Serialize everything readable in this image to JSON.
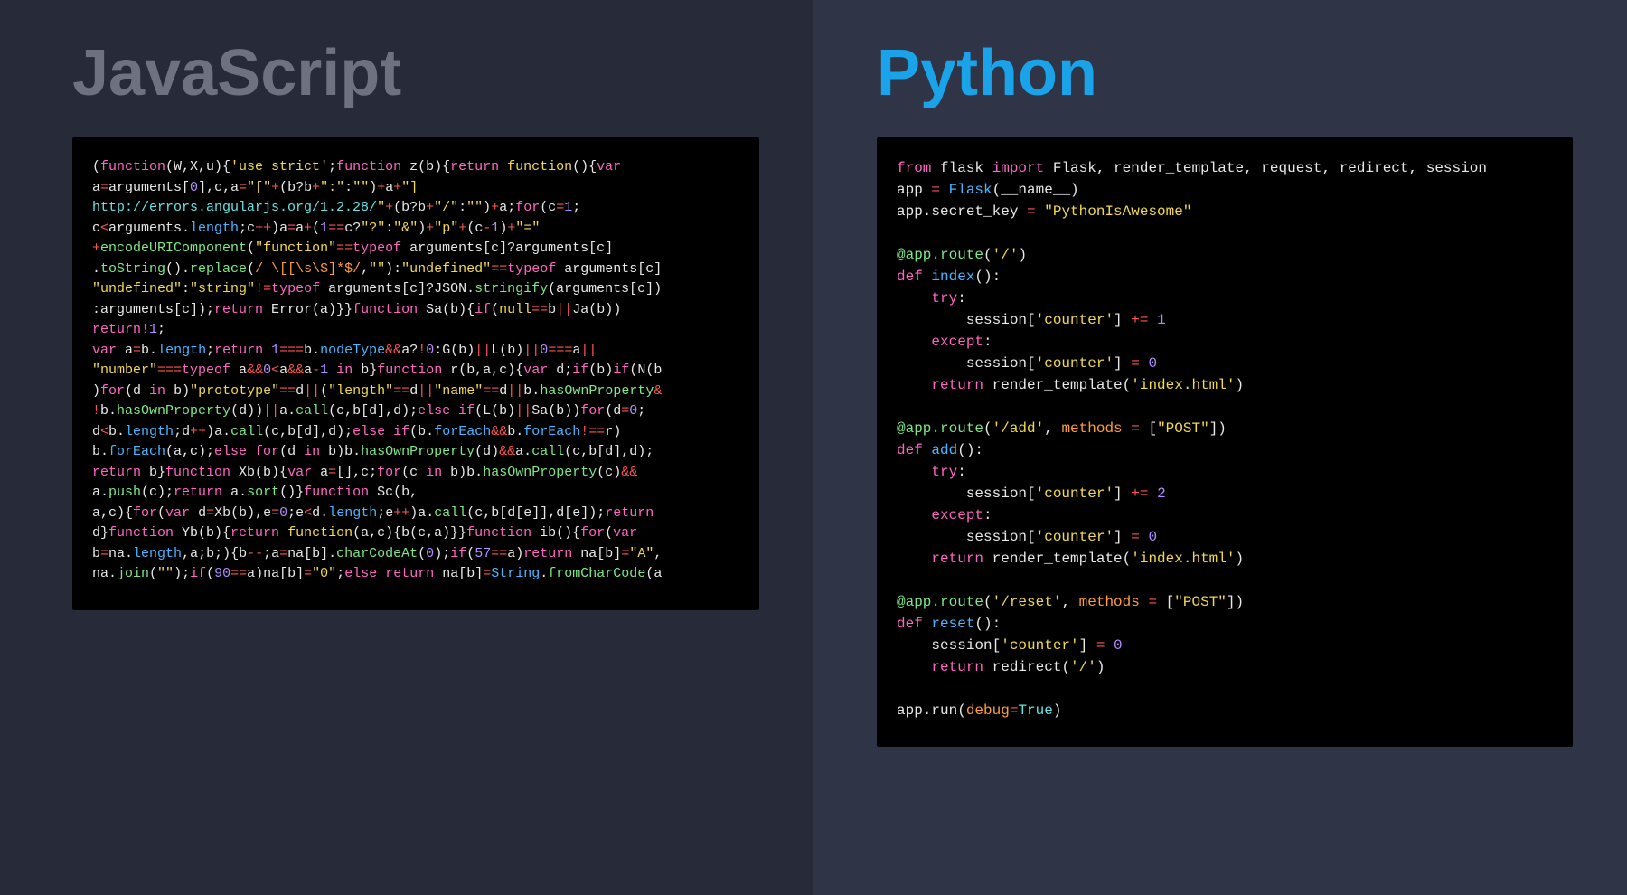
{
  "left": {
    "title": "JavaScript",
    "code_tokens": [
      [
        "w",
        "("
      ],
      [
        "p",
        "function"
      ],
      [
        "w",
        "(W,X,u){"
      ],
      [
        "y",
        "'use strict'"
      ],
      [
        "w",
        ";"
      ],
      [
        "p",
        "function"
      ],
      [
        "w",
        " z(b){"
      ],
      [
        "p",
        "return "
      ],
      [
        "y",
        "function"
      ],
      [
        "w",
        "(){"
      ],
      [
        "p",
        "var"
      ],
      [
        "w",
        "\na"
      ],
      [
        "r",
        "="
      ],
      [
        "w",
        "arguments["
      ],
      [
        "pu",
        "0"
      ],
      [
        "w",
        "],c,a"
      ],
      [
        "r",
        "="
      ],
      [
        "y",
        "\"[\""
      ],
      [
        "r",
        "+"
      ],
      [
        "w",
        "(b?b"
      ],
      [
        "r",
        "+"
      ],
      [
        "y",
        "\":\""
      ],
      [
        "w",
        ":"
      ],
      [
        "y",
        "\"\""
      ],
      [
        "w",
        ")"
      ],
      [
        "r",
        "+"
      ],
      [
        "w",
        "a"
      ],
      [
        "r",
        "+"
      ],
      [
        "y",
        "\"]"
      ],
      [
        "w",
        "\n"
      ],
      [
        "cy",
        "http://errors.angularjs.org/1.2.28/"
      ],
      [
        "y",
        "\""
      ],
      [
        "r",
        "+"
      ],
      [
        "w",
        "(b?b"
      ],
      [
        "r",
        "+"
      ],
      [
        "y",
        "\"/\""
      ],
      [
        "w",
        ":"
      ],
      [
        "y",
        "\"\""
      ],
      [
        "w",
        ")"
      ],
      [
        "r",
        "+"
      ],
      [
        "w",
        "a;"
      ],
      [
        "p",
        "for"
      ],
      [
        "w",
        "(c"
      ],
      [
        "r",
        "="
      ],
      [
        "pu",
        "1"
      ],
      [
        "w",
        ";\nc"
      ],
      [
        "r",
        "<"
      ],
      [
        "w",
        "arguments."
      ],
      [
        "b",
        "length"
      ],
      [
        "w",
        ";c"
      ],
      [
        "r",
        "++"
      ],
      [
        "w",
        ")a"
      ],
      [
        "r",
        "="
      ],
      [
        "w",
        "a"
      ],
      [
        "r",
        "+"
      ],
      [
        "w",
        "("
      ],
      [
        "pu",
        "1"
      ],
      [
        "r",
        "=="
      ],
      [
        "w",
        "c?"
      ],
      [
        "y",
        "\"?\""
      ],
      [
        "w",
        ":"
      ],
      [
        "y",
        "\"&\""
      ],
      [
        "w",
        ")"
      ],
      [
        "r",
        "+"
      ],
      [
        "y",
        "\"p\""
      ],
      [
        "r",
        "+"
      ],
      [
        "w",
        "(c"
      ],
      [
        "r",
        "-"
      ],
      [
        "pu",
        "1"
      ],
      [
        "w",
        ")"
      ],
      [
        "r",
        "+"
      ],
      [
        "y",
        "\"=\""
      ],
      [
        "w",
        "\n"
      ],
      [
        "r",
        "+"
      ],
      [
        "g",
        "encodeURIComponent"
      ],
      [
        "w",
        "("
      ],
      [
        "y",
        "\"function\""
      ],
      [
        "r",
        "=="
      ],
      [
        "p",
        "typeof"
      ],
      [
        "w",
        " arguments[c]?arguments[c]\n."
      ],
      [
        "g",
        "toString"
      ],
      [
        "w",
        "()."
      ],
      [
        "g",
        "replace"
      ],
      [
        "w",
        "("
      ],
      [
        "o",
        "/ \\[[\\s\\S]*$/"
      ],
      [
        "w",
        ","
      ],
      [
        "y",
        "\"\""
      ],
      [
        "w",
        "):"
      ],
      [
        "y",
        "\"undefined\""
      ],
      [
        "r",
        "=="
      ],
      [
        "p",
        "typeof"
      ],
      [
        "w",
        " arguments[c]\n"
      ],
      [
        "y",
        "\"undefined\""
      ],
      [
        "w",
        ":"
      ],
      [
        "y",
        "\"string\""
      ],
      [
        "r",
        "!="
      ],
      [
        "p",
        "typeof"
      ],
      [
        "w",
        " arguments[c]?JSON."
      ],
      [
        "g",
        "stringify"
      ],
      [
        "w",
        "(arguments[c])\n:arguments[c]);"
      ],
      [
        "p",
        "return"
      ],
      [
        "w",
        " Error(a)}}"
      ],
      [
        "p",
        "function"
      ],
      [
        "w",
        " Sa(b){"
      ],
      [
        "p",
        "if"
      ],
      [
        "w",
        "("
      ],
      [
        "y",
        "null"
      ],
      [
        "r",
        "=="
      ],
      [
        "w",
        "b"
      ],
      [
        "r",
        "||"
      ],
      [
        "w",
        "Ja(b))\n"
      ],
      [
        "p",
        "return"
      ],
      [
        "r",
        "!"
      ],
      [
        "pu",
        "1"
      ],
      [
        "w",
        ";\n"
      ],
      [
        "p",
        "var"
      ],
      [
        "w",
        " a"
      ],
      [
        "r",
        "="
      ],
      [
        "w",
        "b."
      ],
      [
        "b",
        "length"
      ],
      [
        "w",
        ";"
      ],
      [
        "p",
        "return "
      ],
      [
        "pu",
        "1"
      ],
      [
        "r",
        "==="
      ],
      [
        "w",
        "b."
      ],
      [
        "b",
        "nodeType"
      ],
      [
        "r",
        "&&"
      ],
      [
        "w",
        "a?"
      ],
      [
        "r",
        "!"
      ],
      [
        "pu",
        "0"
      ],
      [
        "w",
        ":G(b)"
      ],
      [
        "r",
        "||"
      ],
      [
        "w",
        "L(b)"
      ],
      [
        "r",
        "||"
      ],
      [
        "pu",
        "0"
      ],
      [
        "r",
        "==="
      ],
      [
        "w",
        "a"
      ],
      [
        "r",
        "||"
      ],
      [
        "w",
        "\n"
      ],
      [
        "y",
        "\"number\""
      ],
      [
        "r",
        "==="
      ],
      [
        "p",
        "typeof"
      ],
      [
        "w",
        " a"
      ],
      [
        "r",
        "&&"
      ],
      [
        "pu",
        "0"
      ],
      [
        "r",
        "<"
      ],
      [
        "w",
        "a"
      ],
      [
        "r",
        "&&"
      ],
      [
        "w",
        "a"
      ],
      [
        "r",
        "-"
      ],
      [
        "pu",
        "1 "
      ],
      [
        "p",
        "in"
      ],
      [
        "w",
        " b}"
      ],
      [
        "p",
        "function"
      ],
      [
        "w",
        " r(b,a,c){"
      ],
      [
        "p",
        "var"
      ],
      [
        "w",
        " d;"
      ],
      [
        "p",
        "if"
      ],
      [
        "w",
        "(b)"
      ],
      [
        "p",
        "if"
      ],
      [
        "w",
        "(N(b\n)"
      ],
      [
        "p",
        "for"
      ],
      [
        "w",
        "(d "
      ],
      [
        "p",
        "in"
      ],
      [
        "w",
        " b)"
      ],
      [
        "y",
        "\"prototype\""
      ],
      [
        "r",
        "=="
      ],
      [
        "w",
        "d"
      ],
      [
        "r",
        "||"
      ],
      [
        "w",
        "("
      ],
      [
        "y",
        "\"length\""
      ],
      [
        "r",
        "=="
      ],
      [
        "w",
        "d"
      ],
      [
        "r",
        "||"
      ],
      [
        "y",
        "\"name\""
      ],
      [
        "r",
        "=="
      ],
      [
        "w",
        "d"
      ],
      [
        "r",
        "||"
      ],
      [
        "w",
        "b."
      ],
      [
        "g",
        "hasOwnProperty"
      ],
      [
        "r",
        "&\n!"
      ],
      [
        "w",
        "b."
      ],
      [
        "g",
        "hasOwnProperty"
      ],
      [
        "w",
        "(d))"
      ],
      [
        "r",
        "||"
      ],
      [
        "w",
        "a."
      ],
      [
        "g",
        "call"
      ],
      [
        "w",
        "(c,b[d],d);"
      ],
      [
        "p",
        "else if"
      ],
      [
        "w",
        "(L(b)"
      ],
      [
        "r",
        "||"
      ],
      [
        "w",
        "Sa(b))"
      ],
      [
        "p",
        "for"
      ],
      [
        "w",
        "(d"
      ],
      [
        "r",
        "="
      ],
      [
        "pu",
        "0"
      ],
      [
        "w",
        ";\nd"
      ],
      [
        "r",
        "<"
      ],
      [
        "w",
        "b."
      ],
      [
        "b",
        "length"
      ],
      [
        "w",
        ";d"
      ],
      [
        "r",
        "++"
      ],
      [
        "w",
        ")a."
      ],
      [
        "g",
        "call"
      ],
      [
        "w",
        "(c,b[d],d);"
      ],
      [
        "p",
        "else if"
      ],
      [
        "w",
        "(b."
      ],
      [
        "b",
        "forEach"
      ],
      [
        "r",
        "&&"
      ],
      [
        "w",
        "b."
      ],
      [
        "b",
        "forEach"
      ],
      [
        "r",
        "!=="
      ],
      [
        "w",
        "r)\nb."
      ],
      [
        "b",
        "forEach"
      ],
      [
        "w",
        "(a,c);"
      ],
      [
        "p",
        "else for"
      ],
      [
        "w",
        "(d "
      ],
      [
        "p",
        "in"
      ],
      [
        "w",
        " b)b."
      ],
      [
        "g",
        "hasOwnProperty"
      ],
      [
        "w",
        "(d)"
      ],
      [
        "r",
        "&&"
      ],
      [
        "w",
        "a."
      ],
      [
        "g",
        "call"
      ],
      [
        "w",
        "(c,b[d],d);\n"
      ],
      [
        "p",
        "return"
      ],
      [
        "w",
        " b}"
      ],
      [
        "p",
        "function"
      ],
      [
        "w",
        " Xb(b){"
      ],
      [
        "p",
        "var"
      ],
      [
        "w",
        " a"
      ],
      [
        "r",
        "="
      ],
      [
        "w",
        "[],c;"
      ],
      [
        "p",
        "for"
      ],
      [
        "w",
        "(c "
      ],
      [
        "p",
        "in"
      ],
      [
        "w",
        " b)b."
      ],
      [
        "g",
        "hasOwnProperty"
      ],
      [
        "w",
        "(c)"
      ],
      [
        "r",
        "&&"
      ],
      [
        "w",
        "\na."
      ],
      [
        "g",
        "push"
      ],
      [
        "w",
        "(c);"
      ],
      [
        "p",
        "return"
      ],
      [
        "w",
        " a."
      ],
      [
        "g",
        "sort"
      ],
      [
        "w",
        "()}"
      ],
      [
        "p",
        "function"
      ],
      [
        "w",
        " Sc(b,\na,c){"
      ],
      [
        "p",
        "for"
      ],
      [
        "w",
        "("
      ],
      [
        "p",
        "var"
      ],
      [
        "w",
        " d"
      ],
      [
        "r",
        "="
      ],
      [
        "w",
        "Xb(b),e"
      ],
      [
        "r",
        "="
      ],
      [
        "pu",
        "0"
      ],
      [
        "w",
        ";e"
      ],
      [
        "r",
        "<"
      ],
      [
        "w",
        "d."
      ],
      [
        "b",
        "length"
      ],
      [
        "w",
        ";e"
      ],
      [
        "r",
        "++"
      ],
      [
        "w",
        ")a."
      ],
      [
        "g",
        "call"
      ],
      [
        "w",
        "(c,b[d[e]],d[e]);"
      ],
      [
        "p",
        "return"
      ],
      [
        "w",
        "\nd}"
      ],
      [
        "p",
        "function"
      ],
      [
        "w",
        " Yb(b){"
      ],
      [
        "p",
        "return "
      ],
      [
        "y",
        "function"
      ],
      [
        "w",
        "(a,c){b(c,a)}}"
      ],
      [
        "p",
        "function"
      ],
      [
        "w",
        " ib(){"
      ],
      [
        "p",
        "for"
      ],
      [
        "w",
        "("
      ],
      [
        "p",
        "var"
      ],
      [
        "w",
        "\nb"
      ],
      [
        "r",
        "="
      ],
      [
        "w",
        "na."
      ],
      [
        "b",
        "length"
      ],
      [
        "w",
        ",a;b;){b"
      ],
      [
        "r",
        "--"
      ],
      [
        "w",
        ";a"
      ],
      [
        "r",
        "="
      ],
      [
        "w",
        "na[b]."
      ],
      [
        "g",
        "charCodeAt"
      ],
      [
        "w",
        "("
      ],
      [
        "pu",
        "0"
      ],
      [
        "w",
        ");"
      ],
      [
        "p",
        "if"
      ],
      [
        "w",
        "("
      ],
      [
        "pu",
        "57"
      ],
      [
        "r",
        "=="
      ],
      [
        "w",
        "a)"
      ],
      [
        "p",
        "return"
      ],
      [
        "w",
        " na[b]"
      ],
      [
        "r",
        "="
      ],
      [
        "y",
        "\"A\""
      ],
      [
        "w",
        ",\nna."
      ],
      [
        "g",
        "join"
      ],
      [
        "w",
        "("
      ],
      [
        "y",
        "\"\""
      ],
      [
        "w",
        ");"
      ],
      [
        "p",
        "if"
      ],
      [
        "w",
        "("
      ],
      [
        "pu",
        "90"
      ],
      [
        "r",
        "=="
      ],
      [
        "w",
        "a)na[b]"
      ],
      [
        "r",
        "="
      ],
      [
        "y",
        "\"0\""
      ],
      [
        "w",
        ";"
      ],
      [
        "p",
        "else return"
      ],
      [
        "w",
        " na[b]"
      ],
      [
        "r",
        "="
      ],
      [
        "b",
        "String"
      ],
      [
        "w",
        "."
      ],
      [
        "g",
        "fromCharCode"
      ],
      [
        "w",
        "(a"
      ]
    ]
  },
  "right": {
    "title": "Python",
    "code_tokens": [
      [
        "p",
        "from "
      ],
      [
        "w",
        "flask "
      ],
      [
        "p",
        "import "
      ],
      [
        "w",
        "Flask, render_template, request, redirect, session\n"
      ],
      [
        "w",
        "app "
      ],
      [
        "r",
        "= "
      ],
      [
        "b",
        "Flask"
      ],
      [
        "w",
        "(__name__)\n"
      ],
      [
        "w",
        "app.secret_key "
      ],
      [
        "r",
        "= "
      ],
      [
        "y",
        "\"PythonIsAwesome\""
      ],
      [
        "w",
        "\n\n"
      ],
      [
        "g",
        "@app.route"
      ],
      [
        "w",
        "("
      ],
      [
        "y",
        "'/'"
      ],
      [
        "w",
        ")\n"
      ],
      [
        "p",
        "def "
      ],
      [
        "b",
        "index"
      ],
      [
        "w",
        "():\n    "
      ],
      [
        "p",
        "try"
      ],
      [
        "w",
        ":\n        session["
      ],
      [
        "y",
        "'counter'"
      ],
      [
        "w",
        "] "
      ],
      [
        "r",
        "+= "
      ],
      [
        "pu",
        "1"
      ],
      [
        "w",
        "\n    "
      ],
      [
        "p",
        "except"
      ],
      [
        "w",
        ":\n        session["
      ],
      [
        "y",
        "'counter'"
      ],
      [
        "w",
        "] "
      ],
      [
        "r",
        "= "
      ],
      [
        "pu",
        "0"
      ],
      [
        "w",
        "\n    "
      ],
      [
        "p",
        "return "
      ],
      [
        "w",
        "render_template("
      ],
      [
        "y",
        "'index.html'"
      ],
      [
        "w",
        ")\n\n"
      ],
      [
        "g",
        "@app.route"
      ],
      [
        "w",
        "("
      ],
      [
        "y",
        "'/add'"
      ],
      [
        "w",
        ", "
      ],
      [
        "o",
        "methods"
      ],
      [
        "w",
        " "
      ],
      [
        "r",
        "="
      ],
      [
        "w",
        " ["
      ],
      [
        "y",
        "\"POST\""
      ],
      [
        "w",
        "])\n"
      ],
      [
        "p",
        "def "
      ],
      [
        "b",
        "add"
      ],
      [
        "w",
        "():\n    "
      ],
      [
        "p",
        "try"
      ],
      [
        "w",
        ":\n        session["
      ],
      [
        "y",
        "'counter'"
      ],
      [
        "w",
        "] "
      ],
      [
        "r",
        "+= "
      ],
      [
        "pu",
        "2"
      ],
      [
        "w",
        "\n    "
      ],
      [
        "p",
        "except"
      ],
      [
        "w",
        ":\n        session["
      ],
      [
        "y",
        "'counter'"
      ],
      [
        "w",
        "] "
      ],
      [
        "r",
        "= "
      ],
      [
        "pu",
        "0"
      ],
      [
        "w",
        "\n    "
      ],
      [
        "p",
        "return "
      ],
      [
        "w",
        "render_template("
      ],
      [
        "y",
        "'index.html'"
      ],
      [
        "w",
        ")\n\n"
      ],
      [
        "g",
        "@app.route"
      ],
      [
        "w",
        "("
      ],
      [
        "y",
        "'/reset'"
      ],
      [
        "w",
        ", "
      ],
      [
        "o",
        "methods"
      ],
      [
        "w",
        " "
      ],
      [
        "r",
        "="
      ],
      [
        "w",
        " ["
      ],
      [
        "y",
        "\"POST\""
      ],
      [
        "w",
        "])\n"
      ],
      [
        "p",
        "def "
      ],
      [
        "b",
        "reset"
      ],
      [
        "w",
        "():\n    session["
      ],
      [
        "y",
        "'counter'"
      ],
      [
        "w",
        "] "
      ],
      [
        "r",
        "= "
      ],
      [
        "pu",
        "0"
      ],
      [
        "w",
        "\n    "
      ],
      [
        "p",
        "return "
      ],
      [
        "w",
        "redirect("
      ],
      [
        "y",
        "'/'"
      ],
      [
        "w",
        ")\n\n"
      ],
      [
        "w",
        "app.run("
      ],
      [
        "o",
        "debug"
      ],
      [
        "r",
        "="
      ],
      [
        "cy",
        "True"
      ],
      [
        "w",
        ")"
      ]
    ]
  },
  "token_class_map": {
    "w": "c-w",
    "y": "c-y",
    "p": "c-p",
    "b": "c-b",
    "g": "c-g",
    "o": "c-o",
    "r": "c-r",
    "pu": "c-pu",
    "cy": "c-cy",
    "gr": "c-gr"
  }
}
